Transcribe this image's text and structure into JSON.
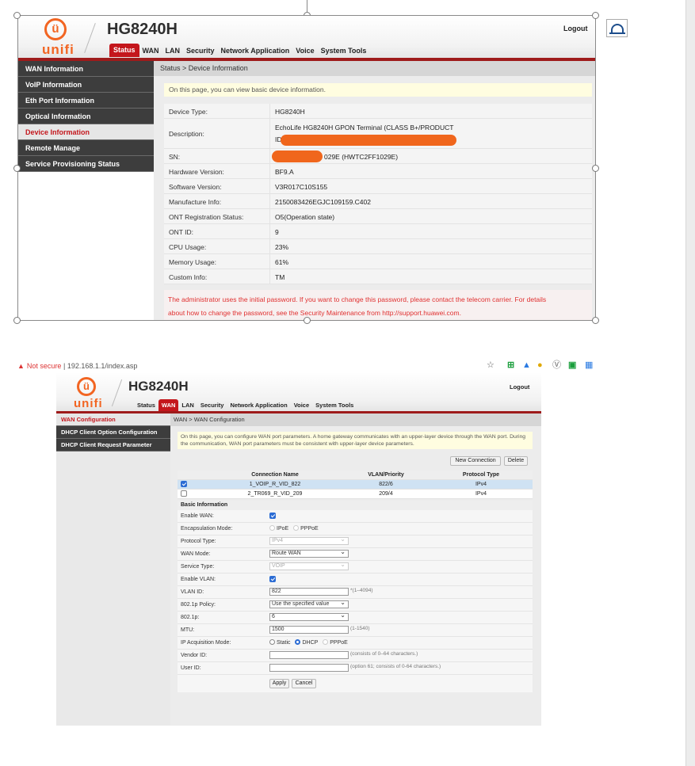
{
  "panel1": {
    "brand": "unifi",
    "model": "HG8240H",
    "logout": "Logout",
    "nav_tabs": [
      "Status",
      "WAN",
      "LAN",
      "Security",
      "Network Application",
      "Voice",
      "System Tools"
    ],
    "sidebar": [
      "WAN Information",
      "VoIP Information",
      "Eth Port Information",
      "Optical Information",
      "Device Information",
      "Remote Manage",
      "Service Provisioning Status"
    ],
    "breadcrumb": "Status > Device Information",
    "notice": "On this page, you can view basic device information.",
    "rows": [
      {
        "key": "Device Type:",
        "value": "HG8240H"
      },
      {
        "key": "Description:",
        "value": "EchoLife HG8240H GPON Terminal (CLASS B+/PRODUCT",
        "value2": "ID"
      },
      {
        "key": "SN:",
        "value": "029E (HWTC2FF1029E)"
      },
      {
        "key": "Hardware Version:",
        "value": "BF9.A"
      },
      {
        "key": "Software Version:",
        "value": "V3R017C10S155"
      },
      {
        "key": "Manufacture Info:",
        "value": "2150083426EGJC109159.C402"
      },
      {
        "key": "ONT Registration Status:",
        "value": "O5(Operation state)"
      },
      {
        "key": "ONT ID:",
        "value": "9"
      },
      {
        "key": "CPU Usage:",
        "value": "23%"
      },
      {
        "key": "Memory Usage:",
        "value": "61%"
      },
      {
        "key": "Custom Info:",
        "value": "TM"
      }
    ],
    "warning_line1": "The administrator uses the initial password. If you want to change this password, please contact the telecom carrier. For details",
    "warning_line2": "about how to change the password, see the Security Maintenance from http://support.huawei.com."
  },
  "browser": {
    "not_secure": "Not secure",
    "separator": "|",
    "url": "192.168.1.1/index.asp"
  },
  "panel2": {
    "brand": "unifi",
    "model": "HG8240H",
    "logout": "Logout",
    "nav_tabs": [
      "Status",
      "WAN",
      "LAN",
      "Security",
      "Network Application",
      "Voice",
      "System Tools"
    ],
    "sidebar": [
      "WAN Configuration",
      "DHCP Client Option Configuration",
      "DHCP Client Request Parameter"
    ],
    "breadcrumb": "WAN > WAN Configuration",
    "notice": "On this page, you can configure WAN port parameters. A home gateway communicates with an upper-layer device through the WAN port. During the communication, WAN port parameters must be consistent with upper-layer device parameters.",
    "new_connection": "New Connection",
    "delete": "Delete",
    "table_headers": [
      "Connection Name",
      "VLAN/Priority",
      "Protocol Type"
    ],
    "connections": [
      {
        "name": "1_VOIP_R_VID_822",
        "vlan": "822/6",
        "protocol": "IPv4",
        "checked": true
      },
      {
        "name": "2_TR069_R_VID_209",
        "vlan": "209/4",
        "protocol": "IPv4",
        "checked": false
      }
    ],
    "basic_info": "Basic Information",
    "form": {
      "enable_wan": "Enable WAN:",
      "encap": "Encapsulation Mode:",
      "encap_ipoe": "IPoE",
      "encap_pppoe": "PPPoE",
      "protocol_type": "Protocol Type:",
      "protocol_value": "IPv4",
      "wan_mode": "WAN Mode:",
      "wan_mode_value": "Route WAN",
      "service_type": "Service Type:",
      "service_value": "VOIP",
      "enable_vlan": "Enable VLAN:",
      "vlan_id": "VLAN ID:",
      "vlan_id_value": "822",
      "vlan_hint": "*(1–4094)",
      "policy": "802.1p Policy:",
      "policy_value": "Use the specified value",
      "p8021": "802.1p:",
      "p8021_value": "6",
      "mtu": "MTU:",
      "mtu_value": "1500",
      "mtu_hint": "(1-1540)",
      "ip_mode": "IP Acquisition Mode:",
      "ip_static": "Static",
      "ip_dhcp": "DHCP",
      "ip_pppoe": "PPPoE",
      "vendor": "Vendor ID:",
      "vendor_hint": "(consists of 0–64 characters.)",
      "user": "User ID:",
      "user_hint": "(option 61; consists of 0-64 characters.)"
    },
    "apply": "Apply",
    "cancel": "Cancel"
  },
  "colors": {
    "brand_orange": "#f26522",
    "tab_red": "#c4161c",
    "sidebar_dark": "#3d3d3d",
    "warning_red": "#e03030",
    "redaction": "#f0661c"
  }
}
